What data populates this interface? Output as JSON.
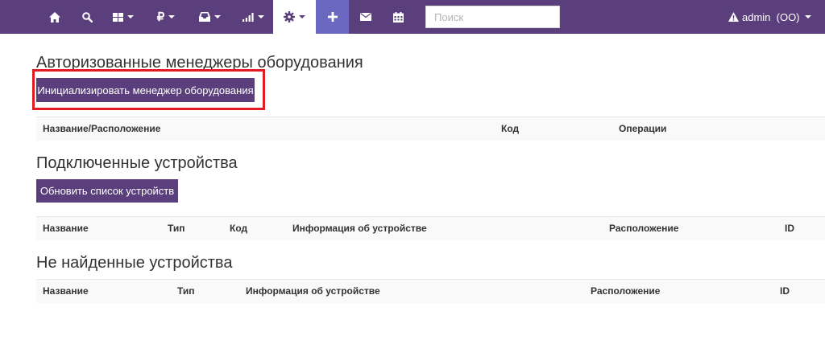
{
  "navbar": {
    "items": [
      {
        "icon": "home-icon"
      },
      {
        "icon": "search-icon"
      },
      {
        "icon": "grid-icon",
        "dropdown": true
      },
      {
        "icon": "ruble-icon",
        "dropdown": true
      },
      {
        "icon": "inbox-icon",
        "dropdown": true
      },
      {
        "icon": "signal-icon",
        "dropdown": true
      },
      {
        "icon": "gear-icon",
        "dropdown": true,
        "active": true
      },
      {
        "icon": "plus-icon"
      },
      {
        "icon": "envelope-icon"
      },
      {
        "icon": "calendar-icon"
      }
    ],
    "search": {
      "placeholder": "Поиск",
      "value": ""
    },
    "user": {
      "icon": "warning-icon",
      "label": "admin  (OO)"
    }
  },
  "colors": {
    "navbar": "#5b3f7c",
    "button": "#5b3f7c",
    "accent": "#6a68c0",
    "highlight": "#e21b23"
  },
  "sections": {
    "managers": {
      "title": "Авторизованные менеджеры оборудования",
      "button": "Инициализировать менеджер оборудования",
      "columns": [
        "Название/Расположение",
        "Код",
        "Операции"
      ]
    },
    "connected": {
      "title": "Подключенные устройства",
      "button": "Обновить список устройств",
      "columns": [
        "Название",
        "Тип",
        "Код",
        "Информация об устройстве",
        "Расположение",
        "ID"
      ]
    },
    "not_found": {
      "title": "Не найденные устройства",
      "columns": [
        "Название",
        "Тип",
        "Информация об устройстве",
        "Расположение",
        "ID"
      ]
    }
  }
}
